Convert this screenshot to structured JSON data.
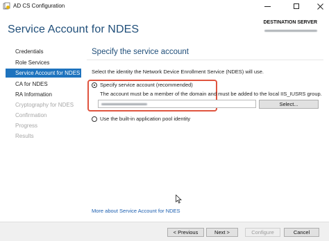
{
  "window": {
    "title": "AD CS Configuration",
    "icons": {
      "app": "ad-cs-icon",
      "minimize": "minimize-icon",
      "maximize": "maximize-icon",
      "close": "close-icon"
    }
  },
  "header": {
    "page_title": "Service Account for NDES",
    "destination_label": "DESTINATION SERVER"
  },
  "sidebar": {
    "items": [
      {
        "label": "Credentials",
        "state": "normal"
      },
      {
        "label": "Role Services",
        "state": "normal"
      },
      {
        "label": "Service Account for NDES",
        "state": "active"
      },
      {
        "label": "CA for NDES",
        "state": "normal"
      },
      {
        "label": "RA Information",
        "state": "normal"
      },
      {
        "label": "Cryptography for NDES",
        "state": "disabled"
      },
      {
        "label": "Confirmation",
        "state": "disabled"
      },
      {
        "label": "Progress",
        "state": "disabled"
      },
      {
        "label": "Results",
        "state": "disabled"
      }
    ]
  },
  "main": {
    "section_title": "Specify the service account",
    "instruction": "Select the identity the Network Device Enrollment Service (NDES) will use.",
    "option_specify": {
      "label": "Specify service account (recommended)",
      "selected": true,
      "note": "The account must be a member of the domain and must be added to the local IIS_IUSRS group.",
      "select_button": "Select..."
    },
    "option_builtin": {
      "label": "Use the built-in application pool identity",
      "selected": false
    },
    "more_link": "More about Service Account for NDES"
  },
  "footer": {
    "previous": "< Previous",
    "next": "Next >",
    "configure": "Configure",
    "cancel": "Cancel"
  },
  "colors": {
    "accent": "#1e73be",
    "title_blue": "#1f4e79",
    "highlight_red": "#e0543f",
    "link": "#1c5fb0"
  }
}
